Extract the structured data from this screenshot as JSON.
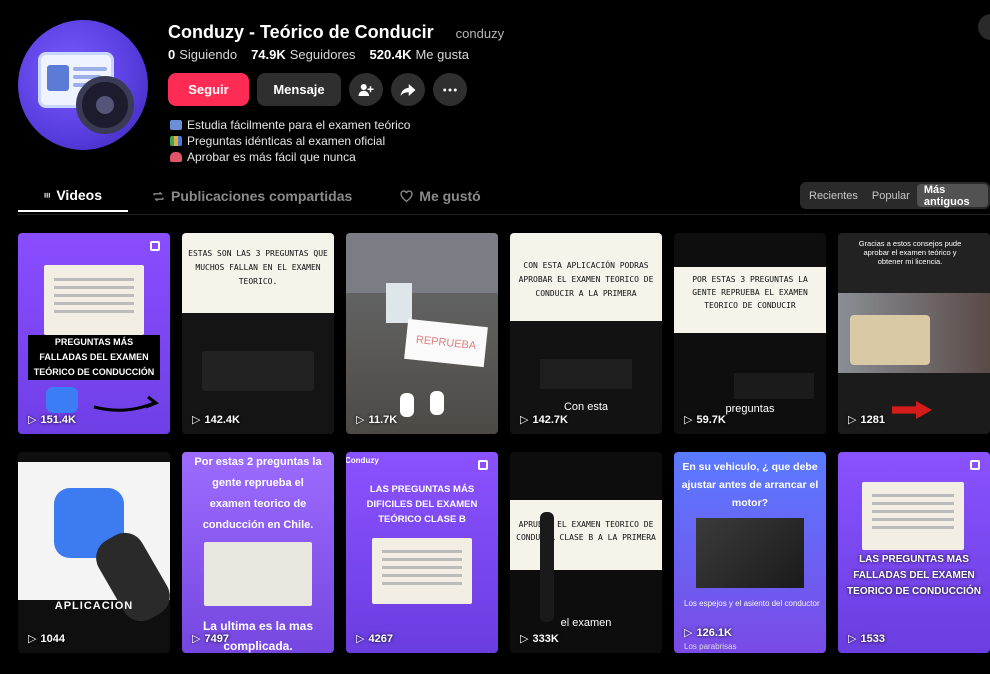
{
  "profile": {
    "name": "Conduzy - Teórico de Conducir",
    "handle": "conduzy",
    "following_count": "0",
    "following_label": "Siguiendo",
    "followers_count": "74.9K",
    "followers_label": "Seguidores",
    "likes_count": "520.4K",
    "likes_label": "Me gusta",
    "follow_label": "Seguir",
    "message_label": "Mensaje",
    "bio": [
      "Estudia fácilmente para el examen teórico",
      "Preguntas idénticas al examen oficial",
      "Aprobar es más fácil que nunca"
    ]
  },
  "tabs": [
    {
      "label": "Videos",
      "icon": "grid-icon",
      "active": true
    },
    {
      "label": "Publicaciones compartidas",
      "icon": "repost-icon",
      "active": false
    },
    {
      "label": "Me gustó",
      "icon": "heart-icon",
      "active": false
    }
  ],
  "sort": [
    "Recientes",
    "Popular",
    "Más antiguos"
  ],
  "videos": [
    {
      "views": "151.4K",
      "caption": "PREGUNTAS MÁS FALLADAS DEL EXAMEN TEÓRICO DE CONDUCCIÓN"
    },
    {
      "views": "142.4K",
      "caption": "ESTAS SON LAS 3 PREGUNTAS QUE MUCHOS FALLAN EN EL EXAMEN TEORICO."
    },
    {
      "views": "11.7K",
      "caption": "REPRUEBA"
    },
    {
      "views": "142.7K",
      "caption": "CON ESTA APLICACIÓN PODRAS APROBAR EL EXAMEN TEORICO DE CONDUCIR A LA PRIMERA",
      "sub": "Con esta"
    },
    {
      "views": "59.7K",
      "caption": "POR ESTAS 3 PREGUNTAS LA GENTE REPRUEBA EL EXAMEN TEORICO DE CONDUCIR",
      "sub": "preguntas"
    },
    {
      "views": "1281",
      "caption": "Gracias a estos consejos pude aprobar el examen teórico y obtener mi licencia."
    },
    {
      "views": "1044",
      "caption": "APLICACION"
    },
    {
      "views": "7497",
      "caption": "Por estas 2 preguntas la gente reprueba el examen teorico de conducción en Chile.",
      "sub": "La ultima es la mas complicada."
    },
    {
      "views": "4267",
      "caption": "LAS PREGUNTAS MÁS DIFICILES DEL EXAMEN TEÓRICO CLASE B",
      "brand": "Conduzy"
    },
    {
      "views": "333K",
      "caption": "APRUEBE EL EXAMEN TEORICO DE CONDUCIR CLASE B A LA PRIMERA",
      "sub": "el examen"
    },
    {
      "views": "126.1K",
      "caption": "En su vehiculo, ¿ que debe ajustar antes de arrancar el motor?",
      "opt1": "Los espejos y el asiento del conductor",
      "opt2": "Los parabrisas"
    },
    {
      "views": "1533",
      "caption": "LAS PREGUNTAS MAS FALLADAS DEL EXAMEN TEORICO DE CONDUCCIÓN"
    }
  ]
}
